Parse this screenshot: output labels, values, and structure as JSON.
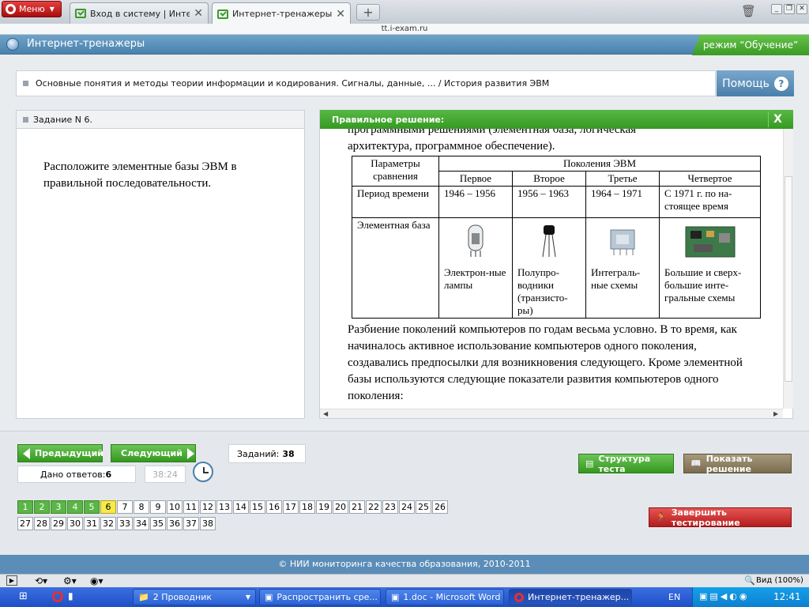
{
  "browser": {
    "menu_label": "Меню",
    "tabs": [
      {
        "title": "Вход в систему | Интер…",
        "active": false
      },
      {
        "title": "Интернет-тренажеры",
        "active": true
      }
    ],
    "url": "tt.i-exam.ru",
    "status": {
      "zoom": "Вид (100%)"
    }
  },
  "app": {
    "title": "Интернет-тренажеры",
    "mode": "режим “Обучение”",
    "breadcrumb": "Основные понятия и методы теории информации и кодирования. Сигналы, данные, ... / История развития ЭВМ",
    "help_label": "Помощь"
  },
  "task": {
    "header": "Задание N 6.",
    "text": "Расположите элементные базы ЭВМ в правильной последовательности."
  },
  "solution": {
    "header": "Правильное решение:",
    "close": "X",
    "intro_cut": "программными решениями (элементная база, логическая",
    "intro": "архитектура, программное обеспечение).",
    "table": {
      "param_header": "Параметры сравнения",
      "group_header": "Поколения ЭВМ",
      "generations": [
        "Первое",
        "Второе",
        "Третье",
        "Четвертое"
      ],
      "period_label": "Период времени",
      "periods": [
        "1946 – 1956",
        "1956 – 1963",
        "1964 – 1971",
        "С 1971 г. по на-стоящее время"
      ],
      "base_label": "Элементная база",
      "bases": [
        "Электрон-ные лампы",
        "Полупро-водники (транзисто-ры)",
        "Интеграль-ные схемы",
        "Большие и сверх-большие инте-гральные схемы"
      ]
    },
    "paragraph": "Разбиение поколений компьютеров по годам весьма условно. В то время, как начиналось активное использование компьютеров одного поколения, создавались предпосылки для возникновения следующего. Кроме элементной базы используются следующие показатели развития компьютеров одного поколения:"
  },
  "controls": {
    "prev": "Предыдущий",
    "next": "Следующий",
    "tasks_label": "Заданий:",
    "tasks_count": "38",
    "answers_label": "Дано ответов:",
    "answers_count": "6",
    "timer": "38:24",
    "structure": "Структура теста",
    "show_solution": "Показать решение",
    "finish": "Завершить тестирование",
    "numbers_row1": [
      "1",
      "2",
      "3",
      "4",
      "5",
      "6",
      "7",
      "8",
      "9",
      "10",
      "11",
      "12",
      "13",
      "14",
      "15",
      "16",
      "17",
      "18",
      "19",
      "20",
      "21",
      "22",
      "23",
      "24",
      "25",
      "26"
    ],
    "numbers_row2": [
      "27",
      "28",
      "29",
      "30",
      "31",
      "32",
      "33",
      "34",
      "35",
      "36",
      "37",
      "38"
    ],
    "answered_count": 5,
    "current": "6"
  },
  "footer": "© НИИ мониторинга качества образования, 2010-2011",
  "taskbar": {
    "items": [
      {
        "label": "2 Проводник",
        "active": false
      },
      {
        "label": "Распространить сре...",
        "active": false
      },
      {
        "label": "1.doc - Microsoft Word",
        "active": false
      },
      {
        "label": "Интернет-тренажер...",
        "active": true
      }
    ],
    "lang": "EN",
    "time": "12:41"
  },
  "colors": {
    "accent_green": "#3a9a25",
    "accent_blue": "#4a82ad",
    "finish_red": "#cc2a2a",
    "current_task": "#f6e94a"
  }
}
